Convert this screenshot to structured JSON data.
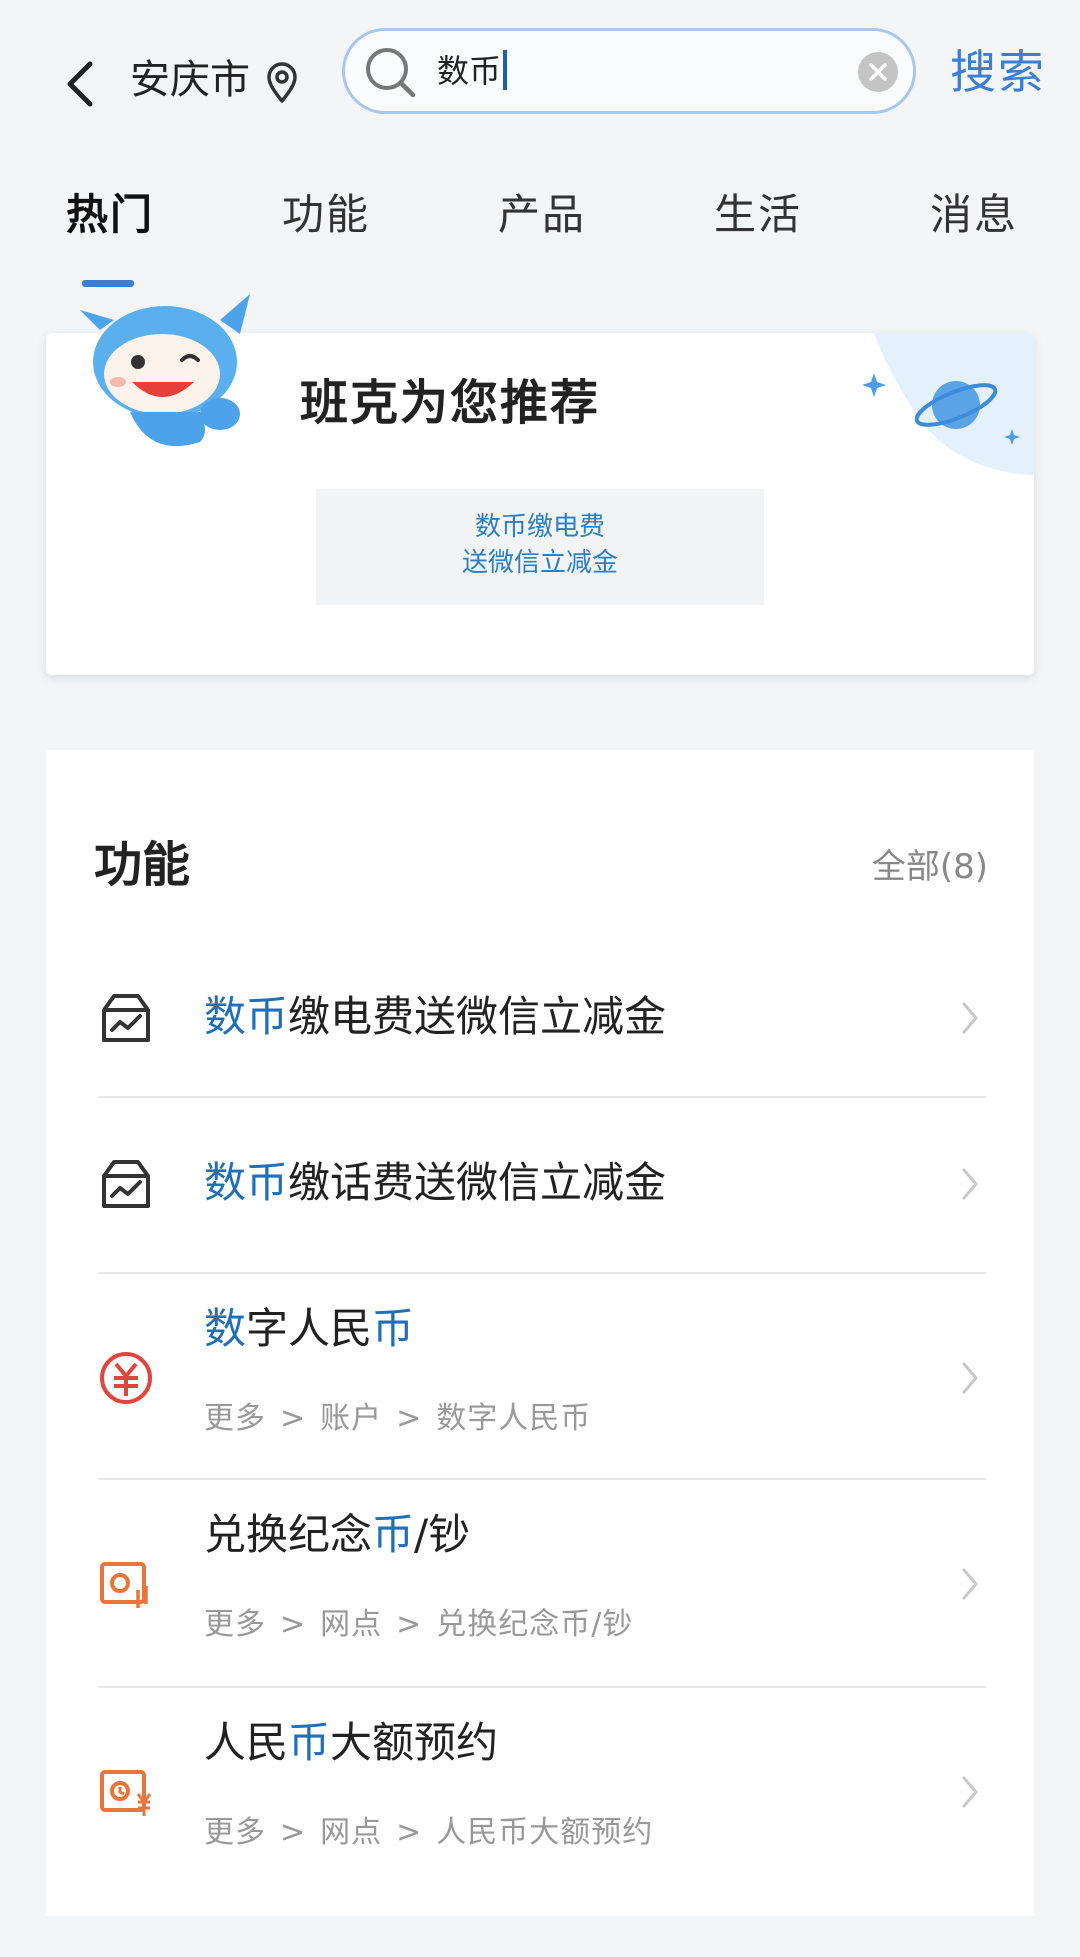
{
  "header": {
    "city": "安庆市",
    "search_query": "数币",
    "search_button": "搜索"
  },
  "tabs": [
    {
      "label": "热门",
      "active": true
    },
    {
      "label": "功能",
      "active": false
    },
    {
      "label": "产品",
      "active": false
    },
    {
      "label": "生活",
      "active": false
    },
    {
      "label": "消息",
      "active": false
    }
  ],
  "recommend": {
    "title": "班克为您推荐",
    "chip_line1": "数币缴电费",
    "chip_line2": "送微信立减金"
  },
  "functions": {
    "title": "功能",
    "view_all": "全部(8)",
    "items": [
      {
        "hl": "数币",
        "rest": "缴电费送微信立减金",
        "icon": "bill-icon"
      },
      {
        "hl": "数币",
        "rest": "缴话费送微信立减金",
        "icon": "bill-icon"
      },
      {
        "title_pre": "",
        "hl1": "数",
        "mid": "字人民",
        "hl2": "币",
        "post": "",
        "path": [
          "更多",
          "账户",
          "数字人民币"
        ],
        "icon": "digital-rmb-icon"
      },
      {
        "title_pre": "兑换纪念",
        "hl1": "币",
        "mid": "/钞",
        "path": [
          "更多",
          "网点",
          "兑换纪念币/钞"
        ],
        "icon": "exchange-coin-icon"
      },
      {
        "title_pre": "人民",
        "hl1": "币",
        "mid": "大额预约",
        "path": [
          "更多",
          "网点",
          "人民币大额预约"
        ],
        "icon": "cash-appointment-icon"
      }
    ],
    "path_separator": ">"
  },
  "colors": {
    "accent": "#3a7fd5",
    "highlight": "#1f6fba",
    "icon_red": "#e0463c",
    "icon_orange": "#e9753a"
  }
}
